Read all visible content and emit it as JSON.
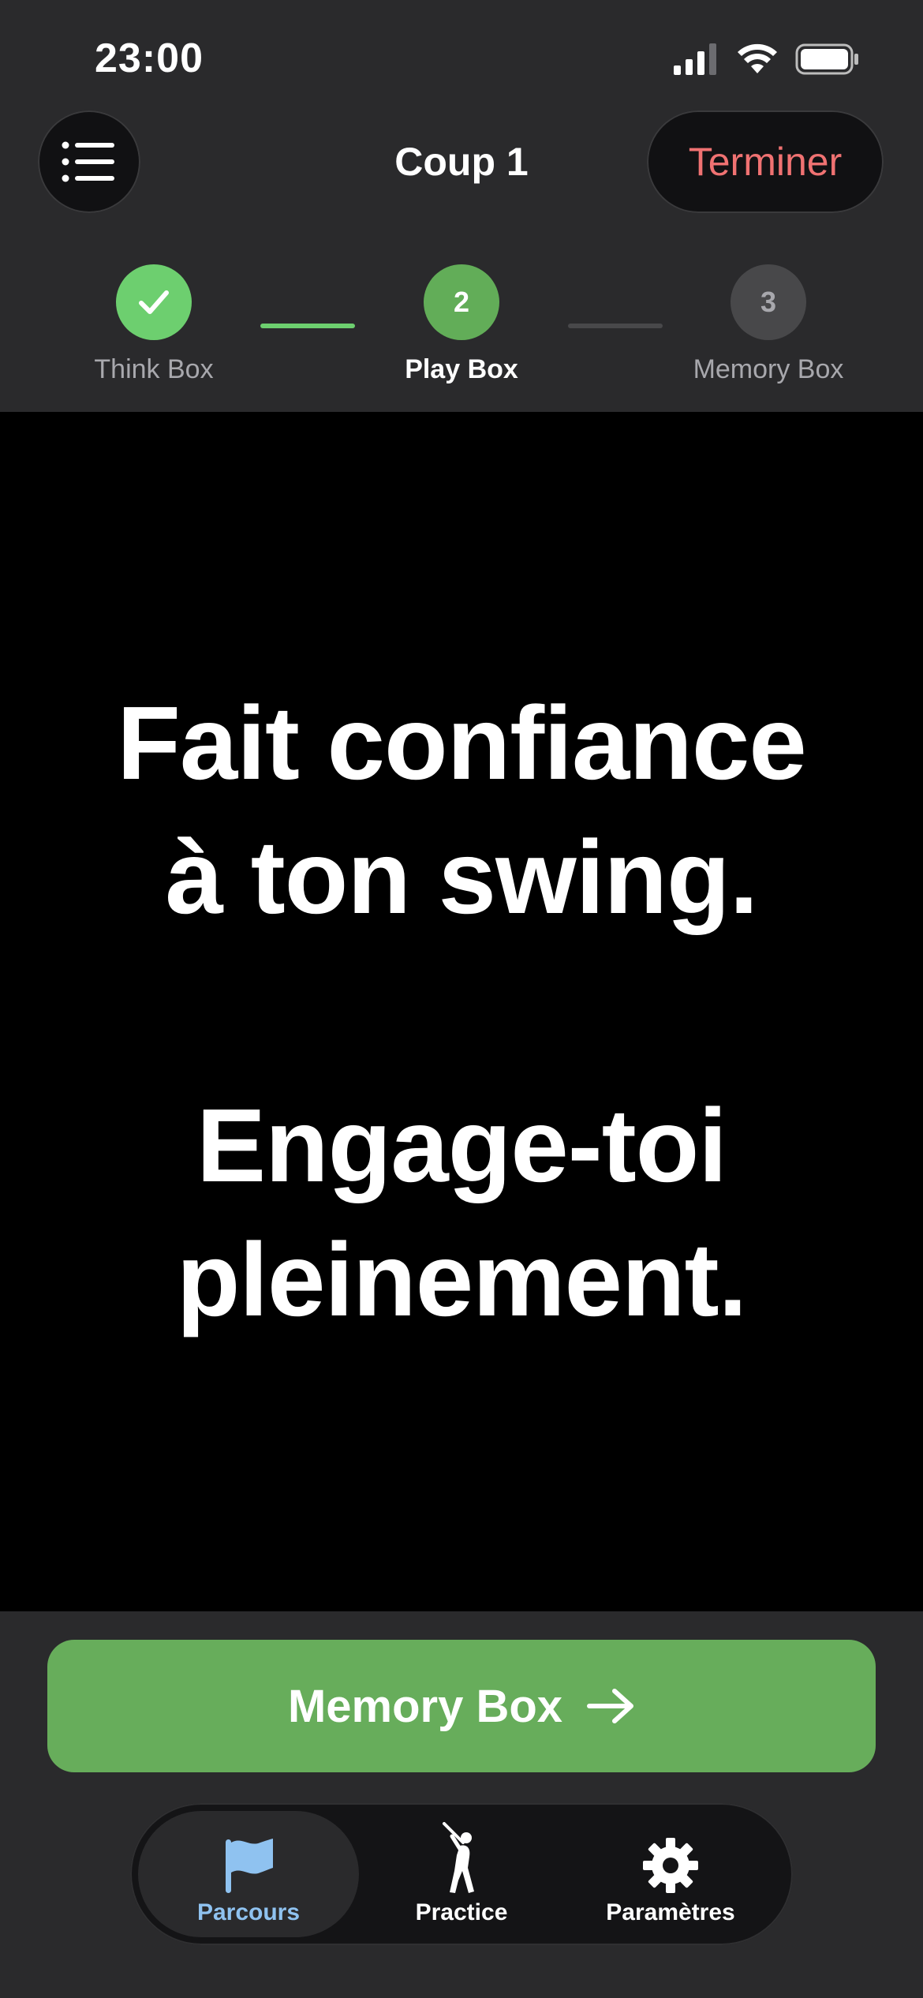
{
  "status_bar": {
    "time": "23:00"
  },
  "header": {
    "title": "Coup 1",
    "end_label": "Terminer"
  },
  "steps": [
    {
      "number": "1",
      "label": "Think Box",
      "state": "done"
    },
    {
      "number": "2",
      "label": "Play Box",
      "state": "active"
    },
    {
      "number": "3",
      "label": "Memory Box",
      "state": "pending"
    }
  ],
  "main": {
    "quote_1": [
      "Fait confiance",
      "à ton swing."
    ],
    "quote_2": [
      "Engage-toi",
      "pleinement."
    ]
  },
  "cta": {
    "label": "Memory Box"
  },
  "tabs": [
    {
      "label": "Parcours",
      "icon": "flag-icon",
      "active": true
    },
    {
      "label": "Practice",
      "icon": "golfer-icon",
      "active": false
    },
    {
      "label": "Paramètres",
      "icon": "gear-icon",
      "active": false
    }
  ],
  "colors": {
    "accent_green": "#67ad5b",
    "done_green": "#6dcf6f",
    "end_red": "#f07272",
    "tab_active": "#8fc2f0"
  }
}
